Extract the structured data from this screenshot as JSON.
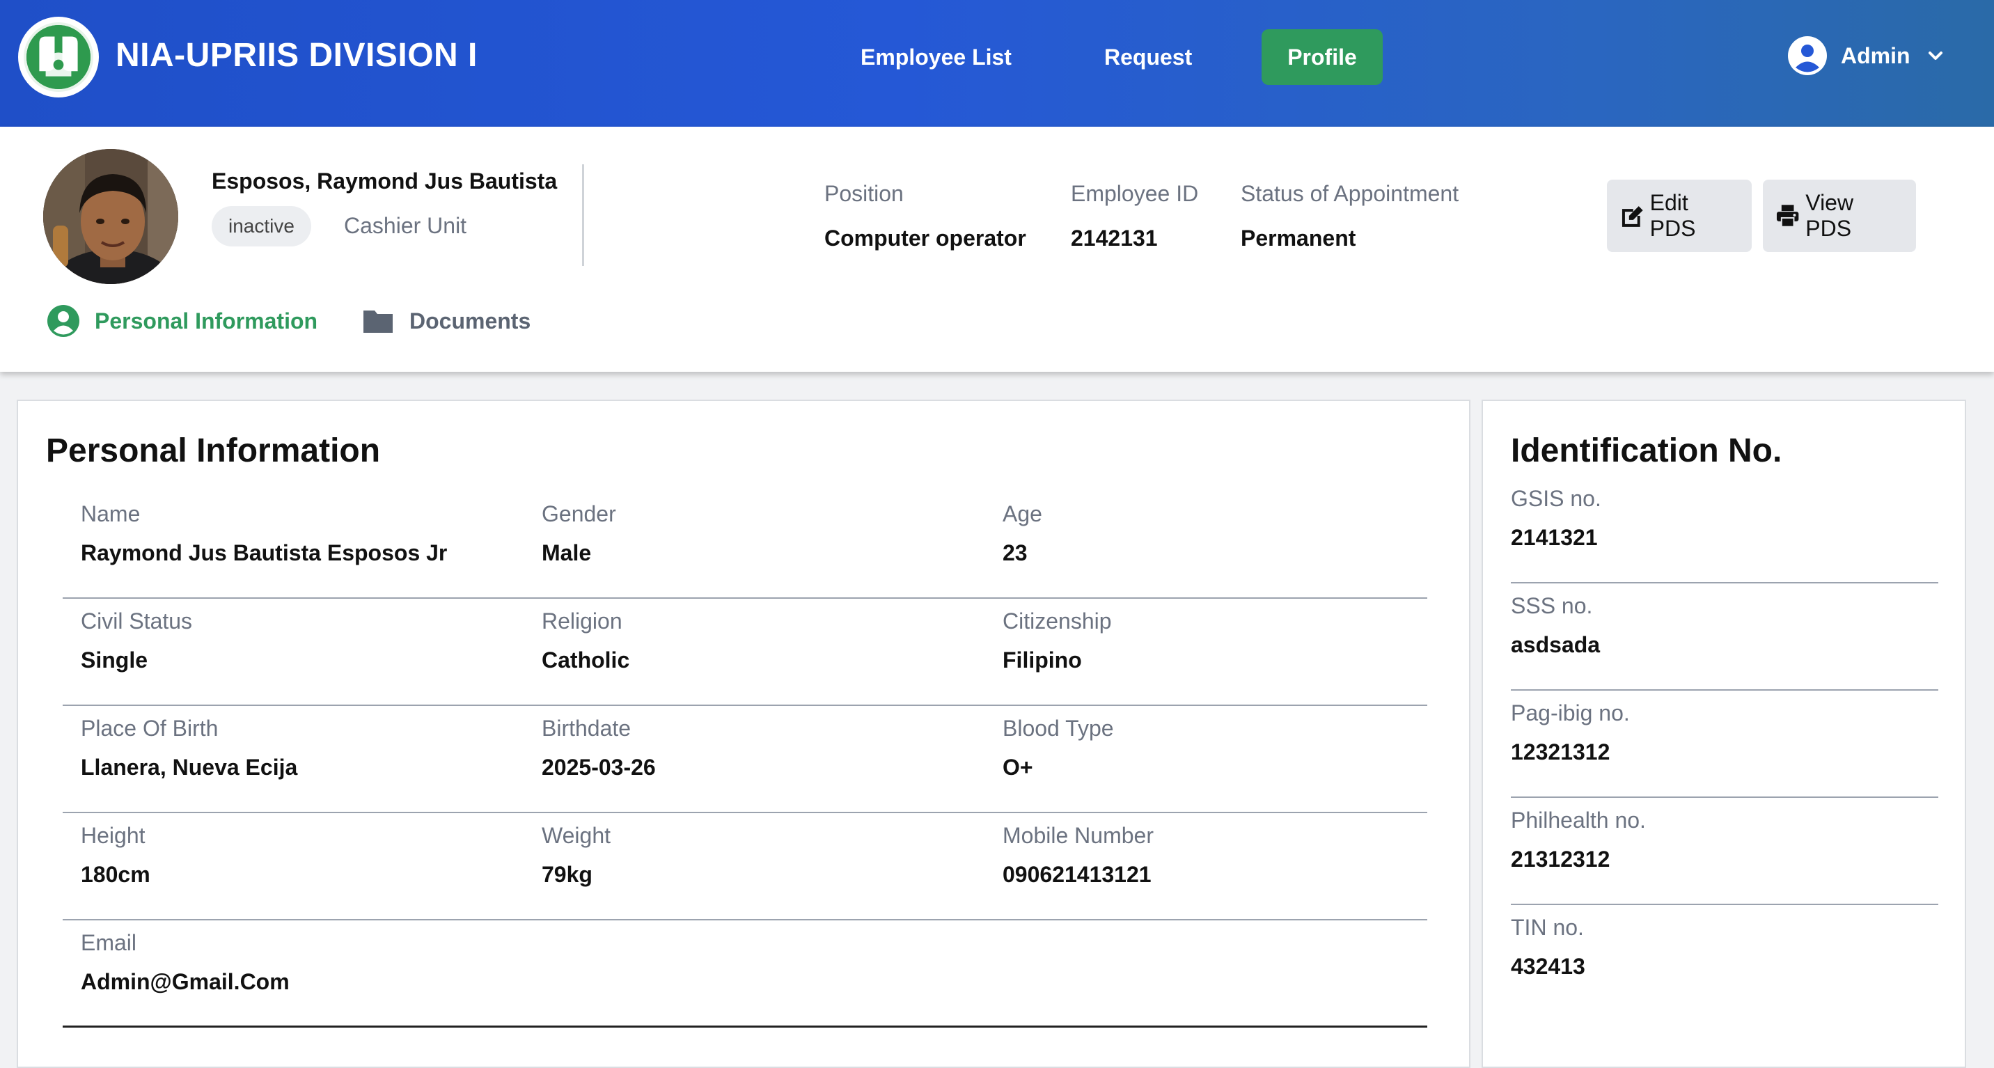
{
  "app": {
    "brand": "NIA-UPRIIS DIVISION I"
  },
  "nav": {
    "employee_list": "Employee List",
    "request": "Request",
    "profile": "Profile",
    "user": "Admin"
  },
  "employee": {
    "display_name": "Esposos, Raymond Jus Bautista",
    "status": "inactive",
    "unit": "Cashier Unit",
    "position_label": "Position",
    "position": "Computer operator",
    "id_label": "Employee ID",
    "id": "2142131",
    "appointment_label": "Status of Appointment",
    "appointment": "Permanent"
  },
  "actions": {
    "edit": "Edit PDS",
    "view": "View PDS"
  },
  "tabs": {
    "personal": "Personal Information",
    "documents": "Documents"
  },
  "personal": {
    "title": "Personal Information",
    "rows": [
      [
        {
          "label": "Name",
          "value": "Raymond Jus Bautista Esposos Jr"
        },
        {
          "label": "Gender",
          "value": "Male"
        },
        {
          "label": "Age",
          "value": "23"
        }
      ],
      [
        {
          "label": "Civil Status",
          "value": "Single"
        },
        {
          "label": "Religion",
          "value": "Catholic"
        },
        {
          "label": "Citizenship",
          "value": "Filipino"
        }
      ],
      [
        {
          "label": "Place Of Birth",
          "value": "Llanera, Nueva Ecija"
        },
        {
          "label": "Birthdate",
          "value": "2025-03-26"
        },
        {
          "label": "Blood Type",
          "value": "O+"
        }
      ],
      [
        {
          "label": "Height",
          "value": "180cm"
        },
        {
          "label": "Weight",
          "value": "79kg"
        },
        {
          "label": "Mobile Number",
          "value": "090621413121"
        }
      ],
      [
        {
          "label": "Email",
          "value": "Admin@Gmail.Com"
        }
      ]
    ]
  },
  "identification": {
    "title": "Identification No.",
    "items": [
      {
        "label": "GSIS no.",
        "value": "2141321"
      },
      {
        "label": "SSS no.",
        "value": "asdsada"
      },
      {
        "label": "Pag-ibig no.",
        "value": "12321312"
      },
      {
        "label": "Philhealth no.",
        "value": "21312312"
      },
      {
        "label": "TIN no.",
        "value": "432413"
      }
    ]
  },
  "colors": {
    "accent_green": "#2f9a5d",
    "nav_blue": "#2558d6"
  },
  "icons": [
    "nia-logo",
    "user-circle-icon",
    "chevron-down-icon",
    "edit-icon",
    "printer-icon",
    "folder-icon"
  ]
}
